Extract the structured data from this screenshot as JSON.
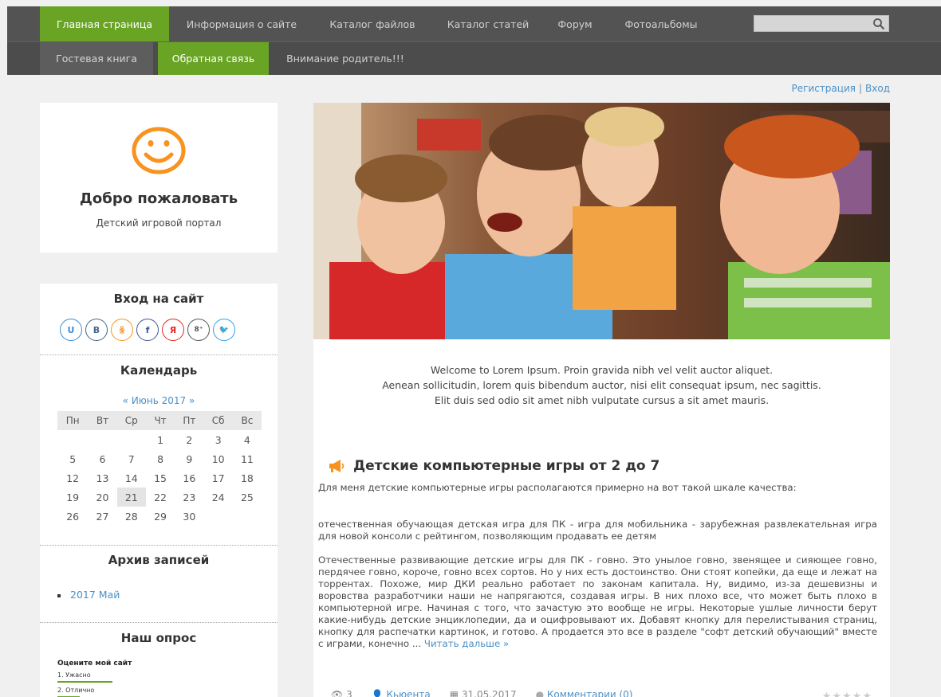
{
  "nav": {
    "primary": [
      {
        "label": "Главная страница",
        "active": true
      },
      {
        "label": "Информация о сайте"
      },
      {
        "label": "Каталог файлов"
      },
      {
        "label": "Каталог статей"
      },
      {
        "label": "Форум"
      },
      {
        "label": "Фотоальбомы"
      }
    ],
    "secondary": [
      {
        "label": "Гостевая книга"
      },
      {
        "label": "Обратная связь",
        "active": true
      },
      {
        "label": "Внимание родитель!!!"
      }
    ],
    "search_value": ""
  },
  "auth": {
    "register": "Регистрация",
    "login": "Вход",
    "separator": "|"
  },
  "welcome": {
    "title": "Добро пожаловать",
    "subtitle": "Детский игровой портал"
  },
  "login_block": {
    "title": "Вход на сайт",
    "providers": [
      {
        "name": "ucoz",
        "glyph": "U",
        "color": "#3b8ad9"
      },
      {
        "name": "vk",
        "glyph": "B",
        "color": "#45668e"
      },
      {
        "name": "odnoklassniki",
        "glyph": "ꆜ",
        "color": "#f7931e"
      },
      {
        "name": "facebook",
        "glyph": "f",
        "color": "#3b5998"
      },
      {
        "name": "yandex",
        "glyph": "Я",
        "color": "#e52620"
      },
      {
        "name": "google-plus",
        "glyph": "8⁺",
        "color": "#555555"
      },
      {
        "name": "twitter",
        "glyph": "🐦",
        "color": "#2aa3ef"
      }
    ]
  },
  "calendar": {
    "title": "Календарь",
    "prev": "«",
    "month": "Июнь 2017",
    "next": "»",
    "weekdays": [
      "Пн",
      "Вт",
      "Ср",
      "Чт",
      "Пт",
      "Сб",
      "Вс"
    ],
    "weeks": [
      [
        "",
        "",
        "",
        "1",
        "2",
        "3",
        "4"
      ],
      [
        "5",
        "6",
        "7",
        "8",
        "9",
        "10",
        "11"
      ],
      [
        "12",
        "13",
        "14",
        "15",
        "16",
        "17",
        "18"
      ],
      [
        "19",
        "20",
        "21",
        "22",
        "23",
        "24",
        "25"
      ],
      [
        "26",
        "27",
        "28",
        "29",
        "30",
        "",
        ""
      ]
    ],
    "today": "21"
  },
  "archive": {
    "title": "Архив записей",
    "items": [
      "2017 Май"
    ]
  },
  "poll": {
    "title": "Наш опрос",
    "question": "Оцените мой сайт",
    "options": [
      {
        "label": "1. Ужасно",
        "share": 0.63
      },
      {
        "label": "2. Отлично",
        "share": 0.25
      }
    ]
  },
  "intro": [
    "Welcome to Lorem Ipsum. Proin gravida nibh vel velit auctor aliquet.",
    "Aenean sollicitudin, lorem quis bibendum auctor, nisi elit consequat ipsum, nec sagittis.",
    "Elit duis sed odio sit amet nibh vulputate cursus a sit amet mauris."
  ],
  "article": {
    "title": "Детские компьютерные игры от 2 до 7",
    "p1": "Для меня детские компьютерные игры располагаются примерно на вот такой шкале качества:",
    "p2": "отечественная обучающая детская игра для ПК - игра для мобильника - зарубежная развлекательная игра для новой консоли с рейтингом, позволяющим продавать ее детям",
    "p3": "Отечественные развивающие детские игры для ПК - говно. Это унылое говно, звенящее и сияющее говно, пердячее говно, короче, говно всех сортов. Но у них есть достоинство. Они стоят копейки, да еще и лежат на торрентах. Похоже, мир ДКИ реально работает по законам капитала. Ну, видимо, из-за дешевизны и воровства разработчики наши не напрягаются, создавая игры. В них плохо все, что может быть плохо в компьютерной игре. Начиная с того, что зачастую это вообще не игры. Некоторые ушлые личности берут какие-нибудь детские энциклопедии, да и оцифровывают их. Добавят кнопку для перелистывания страниц, кнопку для распечатки картинок, и готово. А продается это все в разделе \"софт детский обучающий\" вместе с играми, конечно ...",
    "read_more": "Читать дальше »",
    "views": "3",
    "author": "Кьюента",
    "date": "31.05.2017",
    "comments": "Комментарии (0)",
    "rating": 0
  },
  "colors": {
    "accent": "#69a425",
    "link": "#4a90c8",
    "topbar": "#535353",
    "smiley": "#f7931e"
  }
}
